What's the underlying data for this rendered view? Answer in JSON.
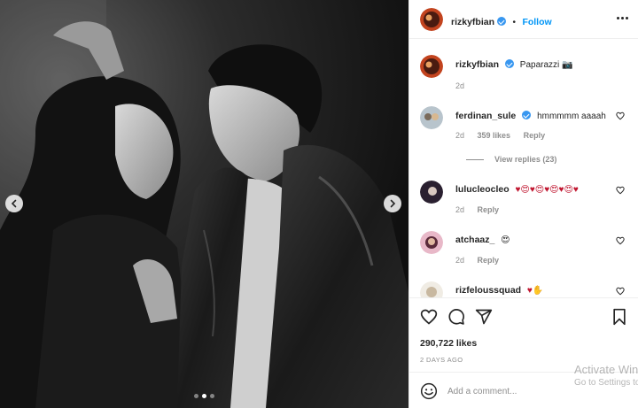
{
  "photo": {
    "carousel": {
      "dot_count": 3,
      "active_index": 1
    }
  },
  "header": {
    "username": "rizkyfbian",
    "follow_label": "Follow"
  },
  "caption": {
    "username": "rizkyfbian",
    "text": "Paparazzi 📷",
    "time": "2d"
  },
  "comments": [
    {
      "username": "ferdinan_sule",
      "verified": true,
      "text": "hmmmmm aaaah",
      "time": "2d",
      "likes": "359 likes",
      "reply": "Reply",
      "view_replies": "View replies (23)"
    },
    {
      "username": "lulucleocleo",
      "verified": false,
      "text": "♥😍♥😍♥😍♥😍♥",
      "time": "2d",
      "reply": "Reply"
    },
    {
      "username": "atchaaz_",
      "verified": false,
      "text": "😍",
      "time": "2d",
      "reply": "Reply"
    },
    {
      "username": "rizfeloussquad",
      "verified": false,
      "text": "♥✋"
    }
  ],
  "actions": {
    "likes": "290,722 likes",
    "date": "2 DAYS AGO"
  },
  "add_comment": {
    "placeholder": "Add a comment..."
  },
  "watermark": {
    "line1": "Activate Windows",
    "line2": "Go to Settings to activate Windows."
  },
  "colors": {
    "link_blue": "#0095f6",
    "verified_blue": "#3897f0",
    "muted_text": "#8e8e8e",
    "border": "#efefef"
  }
}
